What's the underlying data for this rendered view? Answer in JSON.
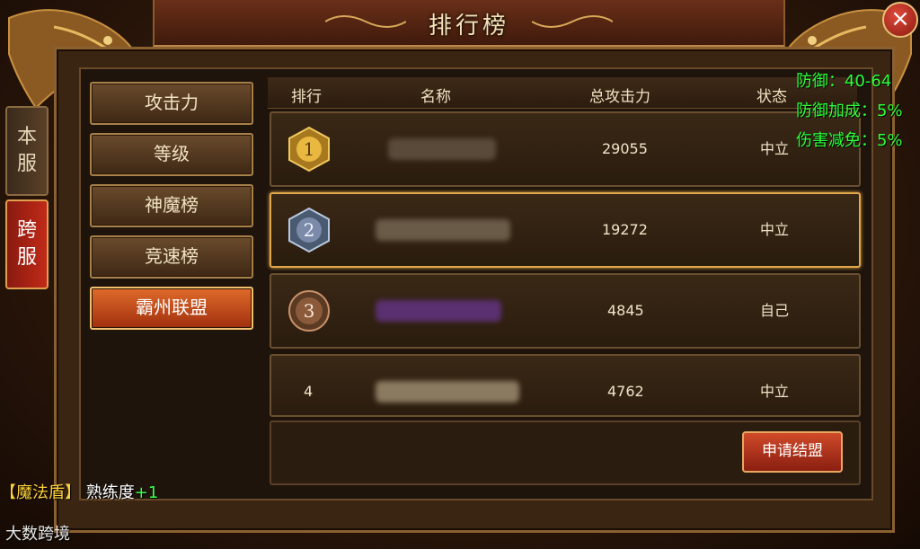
{
  "window": {
    "title": "排行榜",
    "close_label": "×"
  },
  "side_tabs": [
    {
      "label_top": "本",
      "label_bottom": "服"
    },
    {
      "label_top": "跨",
      "label_bottom": "服"
    }
  ],
  "categories": [
    {
      "label": "攻击力",
      "active": false
    },
    {
      "label": "等级",
      "active": false
    },
    {
      "label": "神魔榜",
      "active": false
    },
    {
      "label": "竞速榜",
      "active": false
    },
    {
      "label": "霸州联盟",
      "active": true
    }
  ],
  "table": {
    "headers": {
      "rank": "排行",
      "name": "名称",
      "power": "总攻击力",
      "status": "状态"
    },
    "rows": [
      {
        "rank": "1",
        "power": "29055",
        "status": "中立"
      },
      {
        "rank": "2",
        "power": "19272",
        "status": "中立"
      },
      {
        "rank": "3",
        "power": "4845",
        "status": "自己"
      },
      {
        "rank": "4",
        "power": "4762",
        "status": "中立"
      }
    ]
  },
  "footer": {
    "apply_label": "申请结盟"
  },
  "stats": {
    "defense": "防御：40-64",
    "defense_bonus": "防御加成：5%",
    "damage_reduction": "伤害减免：5%"
  },
  "log": {
    "bracket_open": "【",
    "skill": "魔法盾",
    "bracket_close": "】",
    "text": "熟练度",
    "gain": "+1"
  },
  "watermark": "大数跨境",
  "colors": {
    "accent": "#e0a84a",
    "stat_green": "#2cff3a",
    "active_tab": "#c02a18"
  },
  "icons": {
    "close": "close-icon",
    "rank1": "gold-medal-icon",
    "rank2": "silver-medal-icon",
    "rank3": "bronze-medal-icon"
  }
}
